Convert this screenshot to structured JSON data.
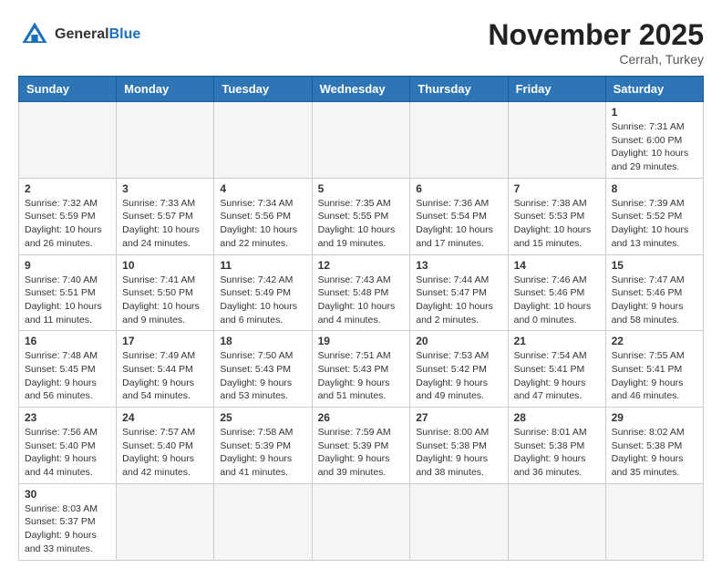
{
  "header": {
    "logo_general": "General",
    "logo_blue": "Blue",
    "month": "November 2025",
    "location": "Cerrah, Turkey"
  },
  "days_of_week": [
    "Sunday",
    "Monday",
    "Tuesday",
    "Wednesday",
    "Thursday",
    "Friday",
    "Saturday"
  ],
  "weeks": [
    [
      {
        "day": "",
        "info": ""
      },
      {
        "day": "",
        "info": ""
      },
      {
        "day": "",
        "info": ""
      },
      {
        "day": "",
        "info": ""
      },
      {
        "day": "",
        "info": ""
      },
      {
        "day": "",
        "info": ""
      },
      {
        "day": "1",
        "info": "Sunrise: 7:31 AM\nSunset: 6:00 PM\nDaylight: 10 hours and 29 minutes."
      }
    ],
    [
      {
        "day": "2",
        "info": "Sunrise: 7:32 AM\nSunset: 5:59 PM\nDaylight: 10 hours and 26 minutes."
      },
      {
        "day": "3",
        "info": "Sunrise: 7:33 AM\nSunset: 5:57 PM\nDaylight: 10 hours and 24 minutes."
      },
      {
        "day": "4",
        "info": "Sunrise: 7:34 AM\nSunset: 5:56 PM\nDaylight: 10 hours and 22 minutes."
      },
      {
        "day": "5",
        "info": "Sunrise: 7:35 AM\nSunset: 5:55 PM\nDaylight: 10 hours and 19 minutes."
      },
      {
        "day": "6",
        "info": "Sunrise: 7:36 AM\nSunset: 5:54 PM\nDaylight: 10 hours and 17 minutes."
      },
      {
        "day": "7",
        "info": "Sunrise: 7:38 AM\nSunset: 5:53 PM\nDaylight: 10 hours and 15 minutes."
      },
      {
        "day": "8",
        "info": "Sunrise: 7:39 AM\nSunset: 5:52 PM\nDaylight: 10 hours and 13 minutes."
      }
    ],
    [
      {
        "day": "9",
        "info": "Sunrise: 7:40 AM\nSunset: 5:51 PM\nDaylight: 10 hours and 11 minutes."
      },
      {
        "day": "10",
        "info": "Sunrise: 7:41 AM\nSunset: 5:50 PM\nDaylight: 10 hours and 9 minutes."
      },
      {
        "day": "11",
        "info": "Sunrise: 7:42 AM\nSunset: 5:49 PM\nDaylight: 10 hours and 6 minutes."
      },
      {
        "day": "12",
        "info": "Sunrise: 7:43 AM\nSunset: 5:48 PM\nDaylight: 10 hours and 4 minutes."
      },
      {
        "day": "13",
        "info": "Sunrise: 7:44 AM\nSunset: 5:47 PM\nDaylight: 10 hours and 2 minutes."
      },
      {
        "day": "14",
        "info": "Sunrise: 7:46 AM\nSunset: 5:46 PM\nDaylight: 10 hours and 0 minutes."
      },
      {
        "day": "15",
        "info": "Sunrise: 7:47 AM\nSunset: 5:46 PM\nDaylight: 9 hours and 58 minutes."
      }
    ],
    [
      {
        "day": "16",
        "info": "Sunrise: 7:48 AM\nSunset: 5:45 PM\nDaylight: 9 hours and 56 minutes."
      },
      {
        "day": "17",
        "info": "Sunrise: 7:49 AM\nSunset: 5:44 PM\nDaylight: 9 hours and 54 minutes."
      },
      {
        "day": "18",
        "info": "Sunrise: 7:50 AM\nSunset: 5:43 PM\nDaylight: 9 hours and 53 minutes."
      },
      {
        "day": "19",
        "info": "Sunrise: 7:51 AM\nSunset: 5:43 PM\nDaylight: 9 hours and 51 minutes."
      },
      {
        "day": "20",
        "info": "Sunrise: 7:53 AM\nSunset: 5:42 PM\nDaylight: 9 hours and 49 minutes."
      },
      {
        "day": "21",
        "info": "Sunrise: 7:54 AM\nSunset: 5:41 PM\nDaylight: 9 hours and 47 minutes."
      },
      {
        "day": "22",
        "info": "Sunrise: 7:55 AM\nSunset: 5:41 PM\nDaylight: 9 hours and 46 minutes."
      }
    ],
    [
      {
        "day": "23",
        "info": "Sunrise: 7:56 AM\nSunset: 5:40 PM\nDaylight: 9 hours and 44 minutes."
      },
      {
        "day": "24",
        "info": "Sunrise: 7:57 AM\nSunset: 5:40 PM\nDaylight: 9 hours and 42 minutes."
      },
      {
        "day": "25",
        "info": "Sunrise: 7:58 AM\nSunset: 5:39 PM\nDaylight: 9 hours and 41 minutes."
      },
      {
        "day": "26",
        "info": "Sunrise: 7:59 AM\nSunset: 5:39 PM\nDaylight: 9 hours and 39 minutes."
      },
      {
        "day": "27",
        "info": "Sunrise: 8:00 AM\nSunset: 5:38 PM\nDaylight: 9 hours and 38 minutes."
      },
      {
        "day": "28",
        "info": "Sunrise: 8:01 AM\nSunset: 5:38 PM\nDaylight: 9 hours and 36 minutes."
      },
      {
        "day": "29",
        "info": "Sunrise: 8:02 AM\nSunset: 5:38 PM\nDaylight: 9 hours and 35 minutes."
      }
    ],
    [
      {
        "day": "30",
        "info": "Sunrise: 8:03 AM\nSunset: 5:37 PM\nDaylight: 9 hours and 33 minutes."
      },
      {
        "day": "",
        "info": ""
      },
      {
        "day": "",
        "info": ""
      },
      {
        "day": "",
        "info": ""
      },
      {
        "day": "",
        "info": ""
      },
      {
        "day": "",
        "info": ""
      },
      {
        "day": "",
        "info": ""
      }
    ]
  ]
}
